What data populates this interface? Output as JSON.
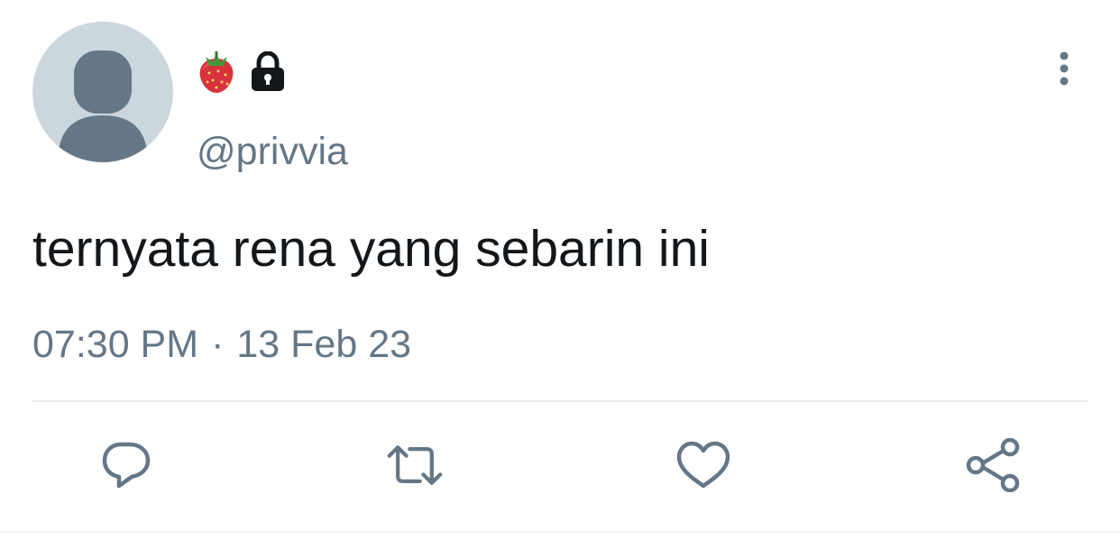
{
  "tweet": {
    "handle": "@privvia",
    "name_icons": [
      "strawberry-emoji",
      "lock-icon"
    ],
    "text": "ternyata rena yang sebarin ini",
    "time": "07:30 PM",
    "separator": "·",
    "date": "13 Feb 23"
  },
  "actions": [
    "reply-icon",
    "retweet-icon",
    "like-icon",
    "share-icon"
  ],
  "colors": {
    "text": "#14171a",
    "secondary": "#657786",
    "avatar_bg": "#ccd6dd",
    "avatar_fg": "#657786",
    "divider": "#e6ecf0"
  }
}
